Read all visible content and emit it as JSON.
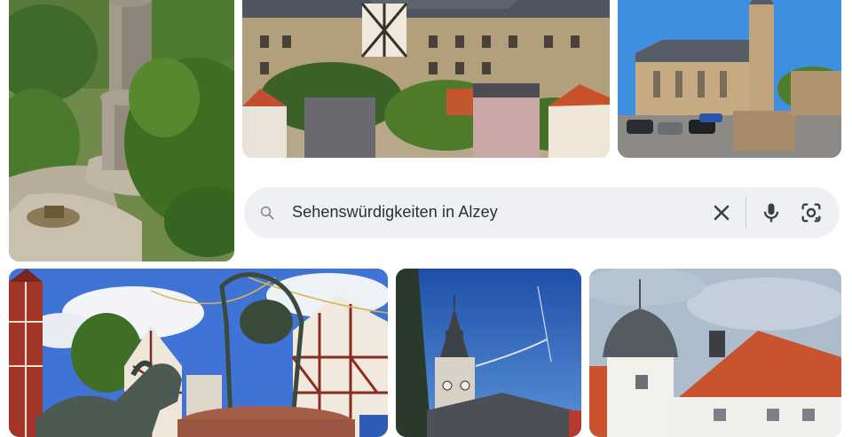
{
  "search": {
    "query": "Sehenswürdigkeiten in Alzey",
    "icons": {
      "search": "search-icon",
      "clear": "close-icon",
      "voice": "microphone-icon",
      "lens": "lens-camera-icon"
    }
  },
  "colors": {
    "search_bg": "#eef0f3",
    "icon_gray": "#5f6368",
    "icon_dark": "#3c4043"
  }
}
